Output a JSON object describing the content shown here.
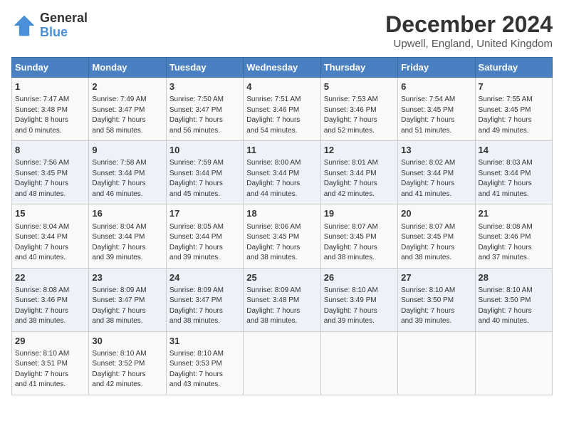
{
  "header": {
    "logo_line1": "General",
    "logo_line2": "Blue",
    "title": "December 2024",
    "subtitle": "Upwell, England, United Kingdom"
  },
  "columns": [
    "Sunday",
    "Monday",
    "Tuesday",
    "Wednesday",
    "Thursday",
    "Friday",
    "Saturday"
  ],
  "weeks": [
    [
      {
        "day": "1",
        "info": "Sunrise: 7:47 AM\nSunset: 3:48 PM\nDaylight: 8 hours\nand 0 minutes."
      },
      {
        "day": "2",
        "info": "Sunrise: 7:49 AM\nSunset: 3:47 PM\nDaylight: 7 hours\nand 58 minutes."
      },
      {
        "day": "3",
        "info": "Sunrise: 7:50 AM\nSunset: 3:47 PM\nDaylight: 7 hours\nand 56 minutes."
      },
      {
        "day": "4",
        "info": "Sunrise: 7:51 AM\nSunset: 3:46 PM\nDaylight: 7 hours\nand 54 minutes."
      },
      {
        "day": "5",
        "info": "Sunrise: 7:53 AM\nSunset: 3:46 PM\nDaylight: 7 hours\nand 52 minutes."
      },
      {
        "day": "6",
        "info": "Sunrise: 7:54 AM\nSunset: 3:45 PM\nDaylight: 7 hours\nand 51 minutes."
      },
      {
        "day": "7",
        "info": "Sunrise: 7:55 AM\nSunset: 3:45 PM\nDaylight: 7 hours\nand 49 minutes."
      }
    ],
    [
      {
        "day": "8",
        "info": "Sunrise: 7:56 AM\nSunset: 3:45 PM\nDaylight: 7 hours\nand 48 minutes."
      },
      {
        "day": "9",
        "info": "Sunrise: 7:58 AM\nSunset: 3:44 PM\nDaylight: 7 hours\nand 46 minutes."
      },
      {
        "day": "10",
        "info": "Sunrise: 7:59 AM\nSunset: 3:44 PM\nDaylight: 7 hours\nand 45 minutes."
      },
      {
        "day": "11",
        "info": "Sunrise: 8:00 AM\nSunset: 3:44 PM\nDaylight: 7 hours\nand 44 minutes."
      },
      {
        "day": "12",
        "info": "Sunrise: 8:01 AM\nSunset: 3:44 PM\nDaylight: 7 hours\nand 42 minutes."
      },
      {
        "day": "13",
        "info": "Sunrise: 8:02 AM\nSunset: 3:44 PM\nDaylight: 7 hours\nand 41 minutes."
      },
      {
        "day": "14",
        "info": "Sunrise: 8:03 AM\nSunset: 3:44 PM\nDaylight: 7 hours\nand 41 minutes."
      }
    ],
    [
      {
        "day": "15",
        "info": "Sunrise: 8:04 AM\nSunset: 3:44 PM\nDaylight: 7 hours\nand 40 minutes."
      },
      {
        "day": "16",
        "info": "Sunrise: 8:04 AM\nSunset: 3:44 PM\nDaylight: 7 hours\nand 39 minutes."
      },
      {
        "day": "17",
        "info": "Sunrise: 8:05 AM\nSunset: 3:44 PM\nDaylight: 7 hours\nand 39 minutes."
      },
      {
        "day": "18",
        "info": "Sunrise: 8:06 AM\nSunset: 3:45 PM\nDaylight: 7 hours\nand 38 minutes."
      },
      {
        "day": "19",
        "info": "Sunrise: 8:07 AM\nSunset: 3:45 PM\nDaylight: 7 hours\nand 38 minutes."
      },
      {
        "day": "20",
        "info": "Sunrise: 8:07 AM\nSunset: 3:45 PM\nDaylight: 7 hours\nand 38 minutes."
      },
      {
        "day": "21",
        "info": "Sunrise: 8:08 AM\nSunset: 3:46 PM\nDaylight: 7 hours\nand 37 minutes."
      }
    ],
    [
      {
        "day": "22",
        "info": "Sunrise: 8:08 AM\nSunset: 3:46 PM\nDaylight: 7 hours\nand 38 minutes."
      },
      {
        "day": "23",
        "info": "Sunrise: 8:09 AM\nSunset: 3:47 PM\nDaylight: 7 hours\nand 38 minutes."
      },
      {
        "day": "24",
        "info": "Sunrise: 8:09 AM\nSunset: 3:47 PM\nDaylight: 7 hours\nand 38 minutes."
      },
      {
        "day": "25",
        "info": "Sunrise: 8:09 AM\nSunset: 3:48 PM\nDaylight: 7 hours\nand 38 minutes."
      },
      {
        "day": "26",
        "info": "Sunrise: 8:10 AM\nSunset: 3:49 PM\nDaylight: 7 hours\nand 39 minutes."
      },
      {
        "day": "27",
        "info": "Sunrise: 8:10 AM\nSunset: 3:50 PM\nDaylight: 7 hours\nand 39 minutes."
      },
      {
        "day": "28",
        "info": "Sunrise: 8:10 AM\nSunset: 3:50 PM\nDaylight: 7 hours\nand 40 minutes."
      }
    ],
    [
      {
        "day": "29",
        "info": "Sunrise: 8:10 AM\nSunset: 3:51 PM\nDaylight: 7 hours\nand 41 minutes."
      },
      {
        "day": "30",
        "info": "Sunrise: 8:10 AM\nSunset: 3:52 PM\nDaylight: 7 hours\nand 42 minutes."
      },
      {
        "day": "31",
        "info": "Sunrise: 8:10 AM\nSunset: 3:53 PM\nDaylight: 7 hours\nand 43 minutes."
      },
      {
        "day": "",
        "info": ""
      },
      {
        "day": "",
        "info": ""
      },
      {
        "day": "",
        "info": ""
      },
      {
        "day": "",
        "info": ""
      }
    ]
  ]
}
